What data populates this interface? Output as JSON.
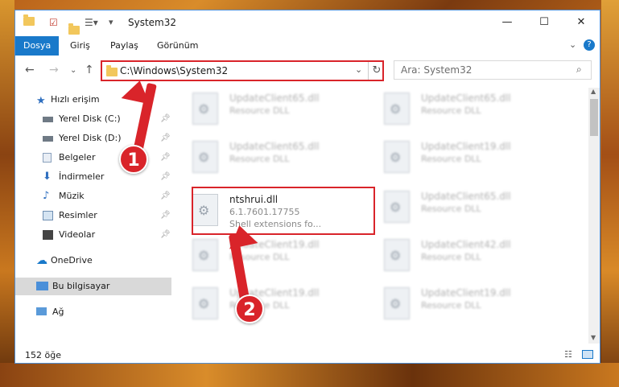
{
  "title": "System32",
  "ribbon": [
    "Dosya",
    "Giriş",
    "Paylaş",
    "Görünüm"
  ],
  "address": "C:\\Windows\\System32",
  "search_placeholder": "Ara: System32",
  "sidebar": [
    {
      "label": "Hızlı erişim",
      "icon": "star-icon"
    },
    {
      "label": "Yerel Disk (C:)",
      "icon": "drive-icon"
    },
    {
      "label": "Yerel Disk (D:)",
      "icon": "drive-icon"
    },
    {
      "label": "Belgeler",
      "icon": "documents-icon"
    },
    {
      "label": "İndirmeler",
      "icon": "download-icon"
    },
    {
      "label": "Müzik",
      "icon": "music-icon"
    },
    {
      "label": "Resimler",
      "icon": "pictures-icon"
    },
    {
      "label": "Videolar",
      "icon": "videos-icon"
    },
    {
      "label": "OneDrive",
      "icon": "cloud-icon"
    },
    {
      "label": "Bu bilgisayar",
      "icon": "computer-icon"
    },
    {
      "label": "Ağ",
      "icon": "network-icon"
    }
  ],
  "files": [
    {
      "name": "UpdateClient65.dll",
      "sub": "Resource DLL"
    },
    {
      "name": "UpdateClient65.dll",
      "sub": "Resource DLL"
    },
    {
      "name": "UpdateClient65.dll",
      "sub": "Resource DLL"
    },
    {
      "name": "UpdateClient19.dll",
      "sub": "Resource DLL"
    },
    {
      "name": "ntshrui.dll",
      "sub": "6.1.7601.17755",
      "sub2": "Shell extensions fo..."
    },
    {
      "name": "UpdateClient65.dll",
      "sub": "Resource DLL"
    },
    {
      "name": "UpdateClient19.dll",
      "sub": "Resource DLL"
    },
    {
      "name": "UpdateClient42.dll",
      "sub": "Resource DLL"
    },
    {
      "name": "UpdateClient19.dll",
      "sub": "Resource DLL"
    },
    {
      "name": "UpdateClient19.dll",
      "sub": "Resource DLL"
    }
  ],
  "status": "152 öğe",
  "steps": [
    "1",
    "2"
  ]
}
